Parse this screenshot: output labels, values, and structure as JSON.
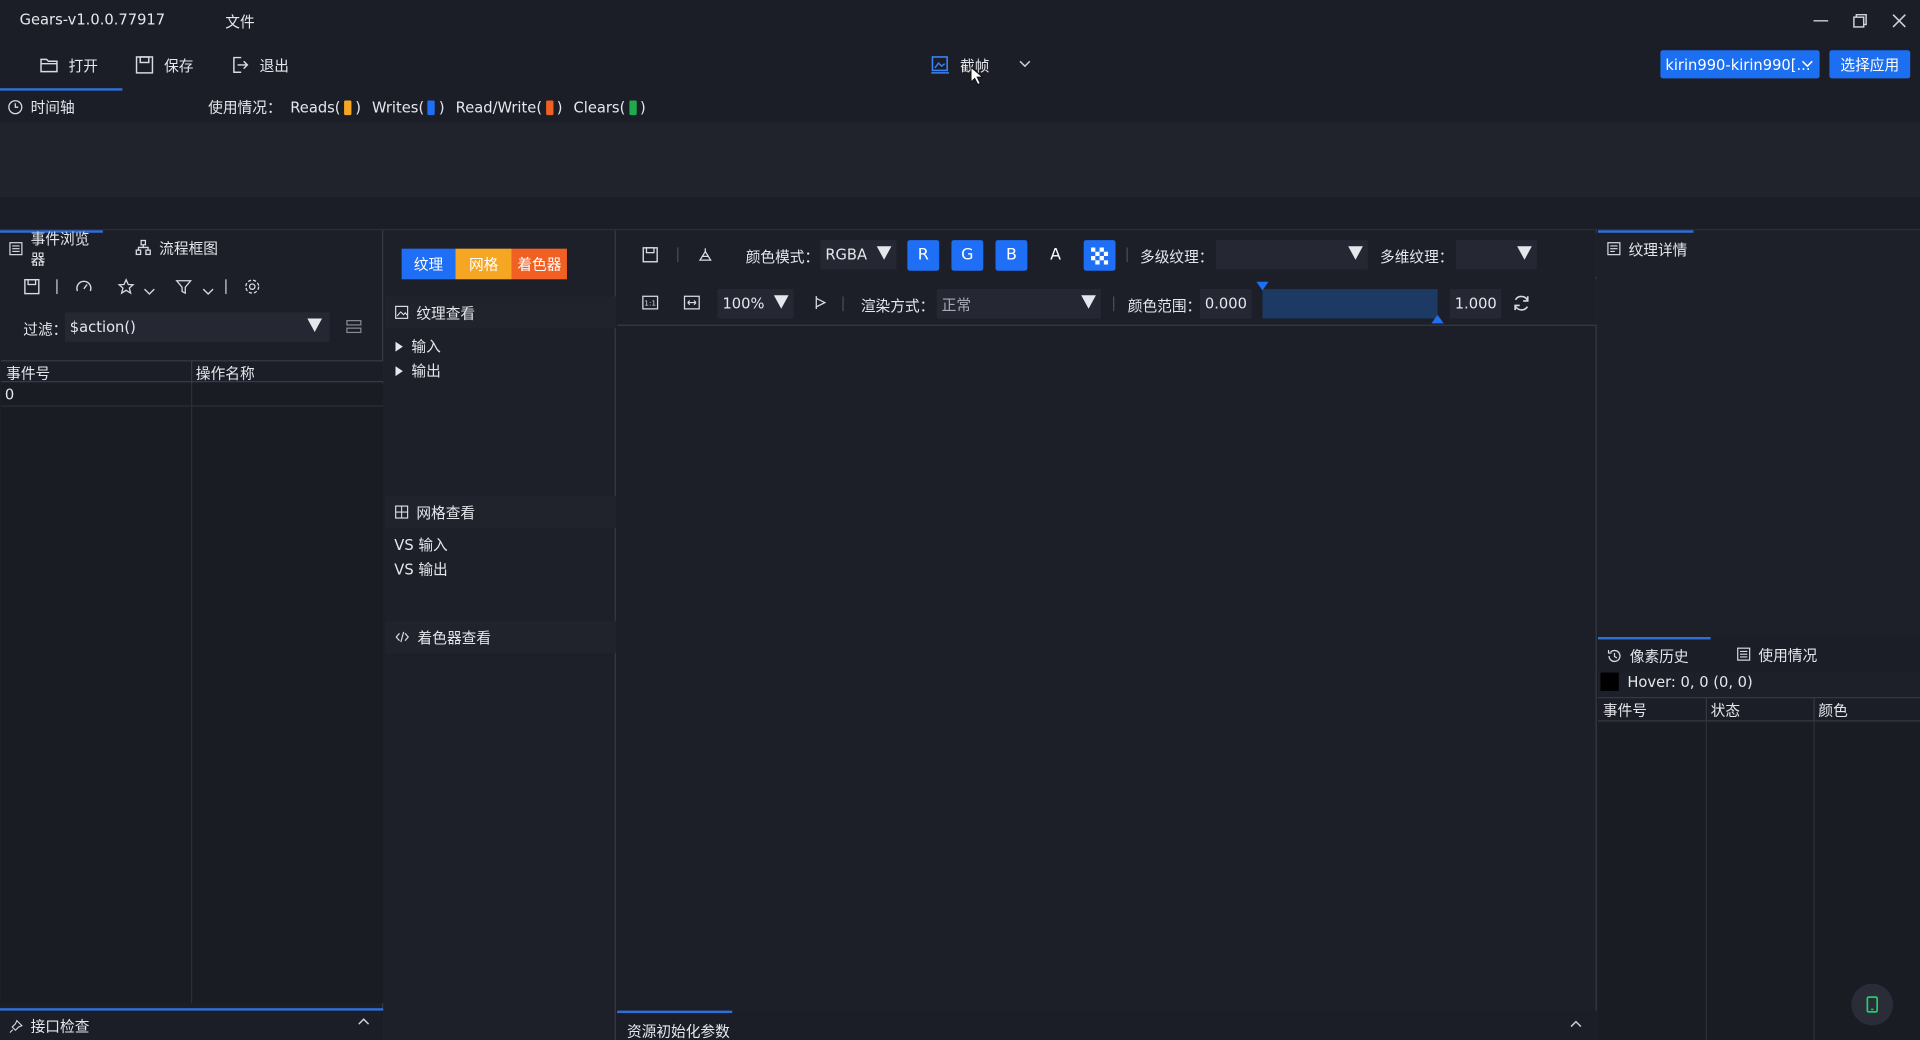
{
  "titlebar": {
    "app_title": "Gears-v1.0.0.77917",
    "menu_file": "文件"
  },
  "toolbar": {
    "open": "打开",
    "save": "保存",
    "exit": "退出",
    "capture": "截帧",
    "device": "kirin990-kirin990[...",
    "apply": "选择应用"
  },
  "timeline": {
    "tab": "时间轴",
    "usage_label": "使用情况：",
    "reads": "Reads(",
    "writes": "Writes(",
    "readwrite": "Read/Write(",
    "clears": "Clears(",
    "close_paren": ")",
    "colors": {
      "reads": "#f5a623",
      "writes": "#1e6ff5",
      "readwrite": "#f06022",
      "clears": "#1faa4b"
    }
  },
  "left": {
    "tab_events": "事件浏览器",
    "tab_flow": "流程框图",
    "filter_label": "过滤：",
    "filter_value": "$action()",
    "columns": [
      "事件号",
      "操作名称"
    ],
    "rows": [
      [
        "0",
        ""
      ]
    ],
    "bottom_tab": "接口检查"
  },
  "resources": {
    "seg_texture": "纹理",
    "seg_mesh": "网格",
    "seg_shader": "着色器",
    "seg_colors": {
      "texture": "#1e6ff5",
      "mesh": "#f5a623",
      "shader": "#f06022"
    },
    "texture_view": "纹理查看",
    "input": "输入",
    "output": "输出",
    "mesh_view": "网格查看",
    "vs_input": "VS 输入",
    "vs_output": "VS 输出",
    "shader_view": "着色器查看"
  },
  "viewer": {
    "color_mode_label": "颜色模式：",
    "color_mode": "RGBA",
    "channel_r": "R",
    "channel_g": "G",
    "channel_b": "B",
    "channel_a": "A",
    "mip_label": "多级纹理：",
    "slice_label": "多维纹理：",
    "zoom": "100%",
    "render_label": "渲染方式：",
    "render_value": "正常",
    "range_label": "颜色范围：",
    "range_min": "0.000",
    "range_max": "1.000",
    "bottom_tab": "资源初始化参数"
  },
  "right": {
    "texture_details": "纹理详情",
    "tab_pixel_history": "像素历史",
    "tab_usage": "使用情况",
    "hover": "Hover: 0, 0 (0, 0)",
    "columns": [
      "事件号",
      "状态",
      "颜色"
    ]
  }
}
